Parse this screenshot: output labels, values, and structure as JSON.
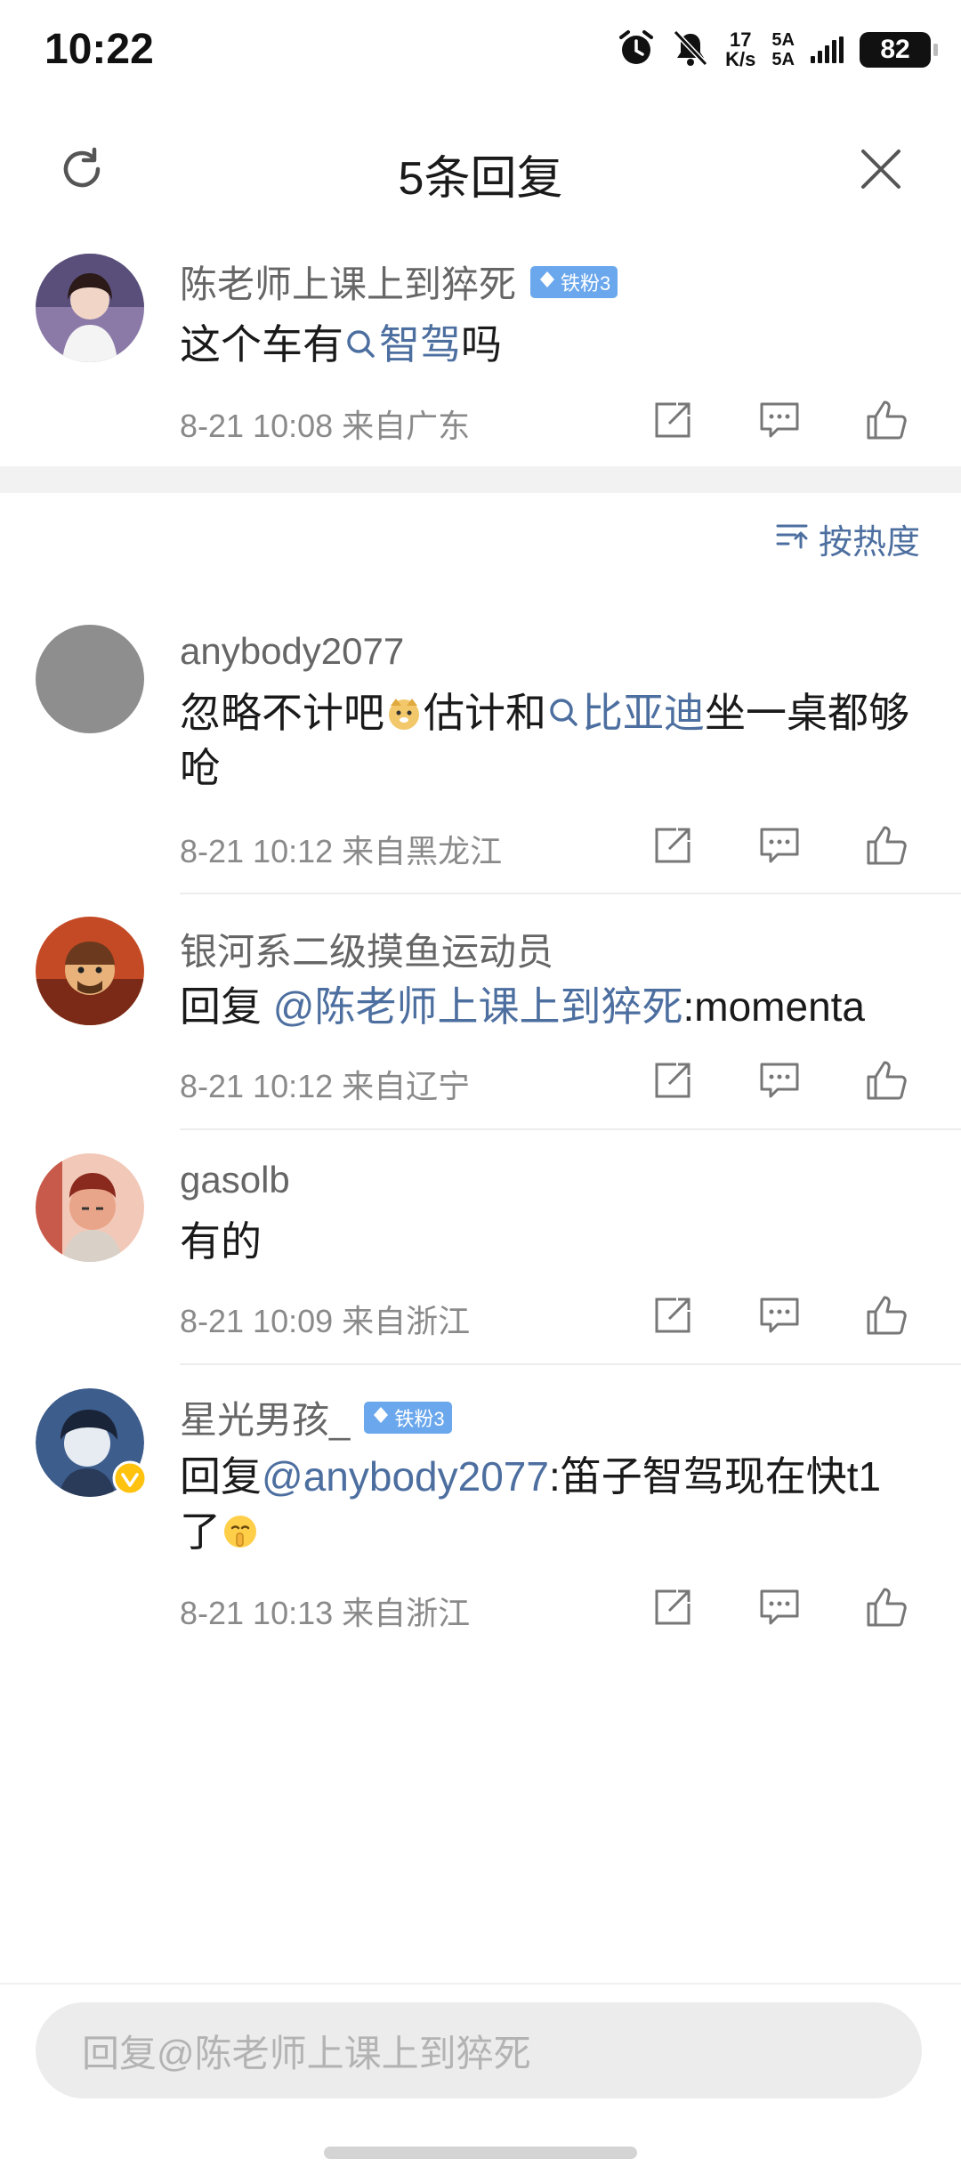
{
  "status_bar": {
    "time": "10:22",
    "speed_value": "17",
    "speed_unit": "K/s",
    "net_top": "5A",
    "net_bottom": "5A",
    "battery": "82",
    "icons": [
      "alarm-icon",
      "bell-off-icon",
      "signal-icon",
      "battery-icon"
    ]
  },
  "header": {
    "title": "5条回复",
    "refresh_icon": "refresh-icon",
    "close_icon": "close-icon"
  },
  "root_comment": {
    "author": "陈老师上课上到猝死",
    "badge": "铁粉3",
    "content_pre": "这个车有",
    "content_link": "智驾",
    "content_post": "吗",
    "meta": "8-21 10:08 来自广东"
  },
  "sort": {
    "label": "按热度"
  },
  "replies": [
    {
      "author": "anybody2077",
      "content_pre": "忽略不计吧",
      "content_mid": "估计和",
      "content_link": "比亚迪",
      "content_post": "坐一桌都够呛",
      "meta": "8-21 10:12 来自黑龙江"
    },
    {
      "author": "银河系二级摸鱼运动员",
      "content_pre": "回复 ",
      "content_link": "@陈老师上课上到猝死",
      "content_post": ":momenta",
      "meta": "8-21 10:12 来自辽宁"
    },
    {
      "author": "gasolb",
      "content": "有的",
      "meta": "8-21 10:09 来自浙江"
    },
    {
      "author": "星光男孩_",
      "badge": "铁粉3",
      "content_pre": "回复",
      "content_link": "@anybody2077",
      "content_post": ":笛子智驾现在快t1了",
      "meta": "8-21 10:13 来自浙江"
    }
  ],
  "footer": {
    "placeholder": "回复@陈老师上课上到猝死"
  },
  "colors": {
    "link": "#4d6fa0",
    "badge": "#6aa7ec",
    "meta": "#8a8a8a"
  }
}
